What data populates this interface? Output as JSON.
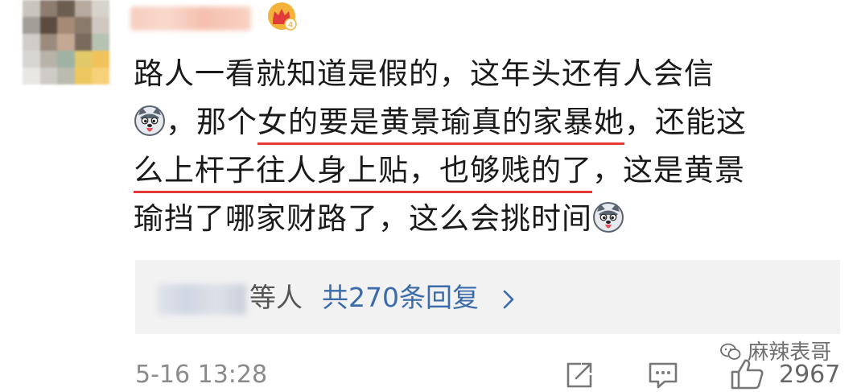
{
  "comment": {
    "author_name": "",
    "lines": [
      {
        "before": "路人一看就知道是假的，这年头还有人会信",
        "underlined": "",
        "after": ""
      },
      {
        "before": "，那个",
        "underlined": "女的要是黄景瑜真的家暴她",
        "after": "，还能这"
      },
      {
        "before": "",
        "underlined": "么上杆子往人身上贴，也够贱的了",
        "after": "，这是黄景"
      },
      {
        "before": "瑜挡了哪家财路了，这么会挑时间",
        "underlined": "",
        "after": ""
      }
    ],
    "emoji_icon": "husky-dog-emoji-icon",
    "vip_level": "4"
  },
  "replies": {
    "suffix": "等人",
    "count_label": "共270条回复"
  },
  "footer": {
    "timestamp": "5-16 13:28",
    "like_count": "2967",
    "icons": [
      "share-icon",
      "comment-icon",
      "like-icon"
    ]
  },
  "watermark": {
    "text": "麻辣表哥"
  },
  "colors": {
    "underline": "#e53935",
    "link": "#3b6bab",
    "reply_bg": "#f2f2f2",
    "meta_text": "#8a8a8a"
  }
}
